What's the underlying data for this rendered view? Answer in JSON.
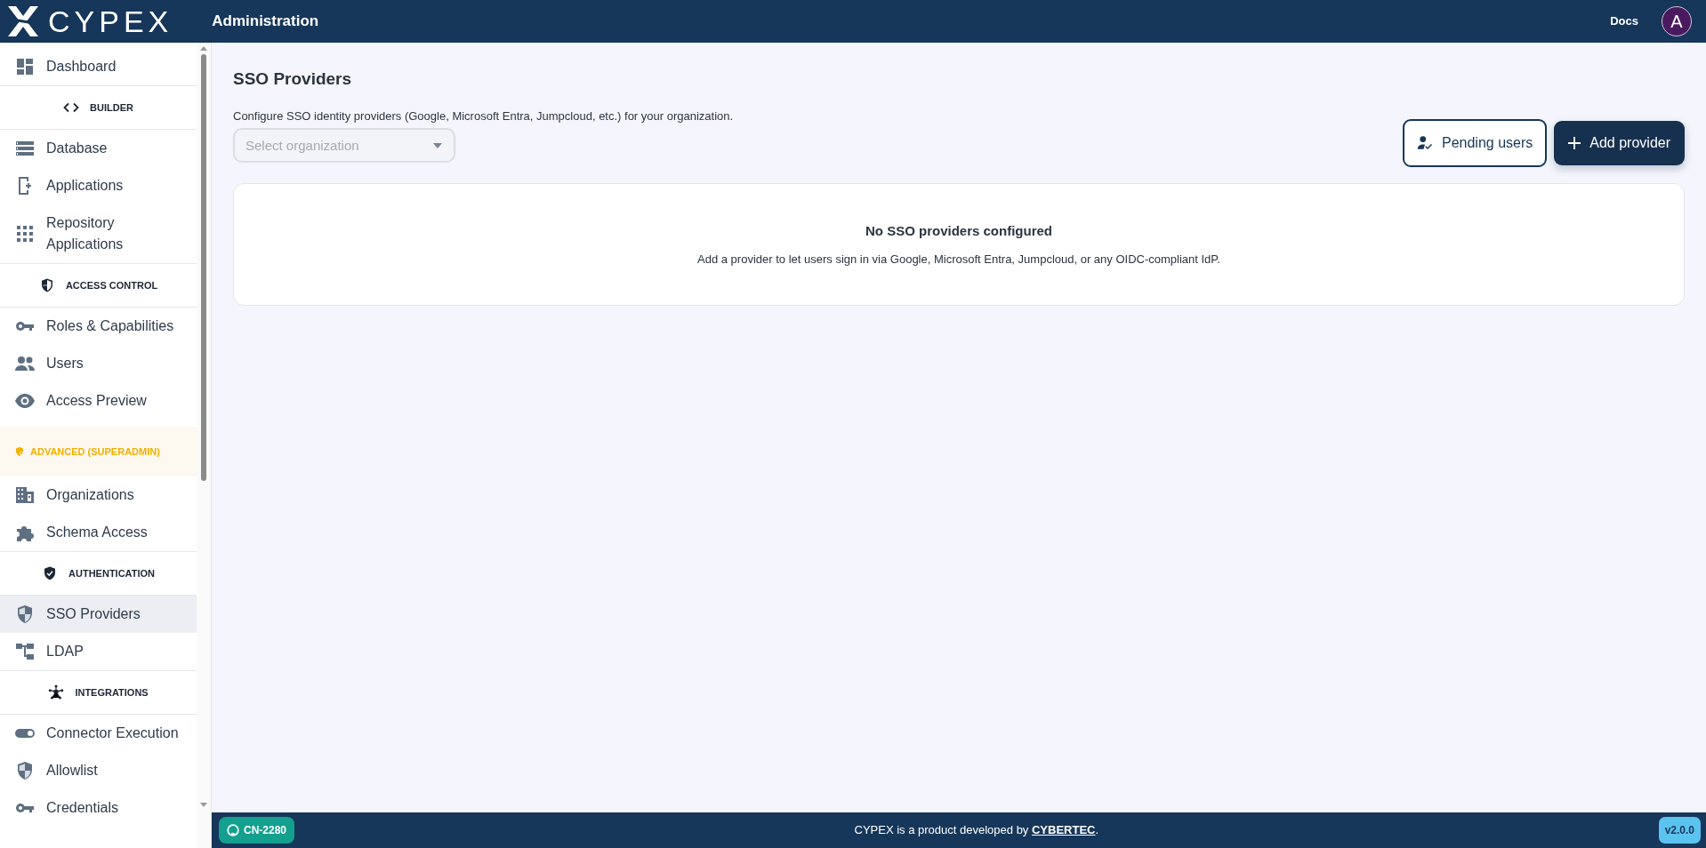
{
  "header": {
    "logo": "CYPEX",
    "title": "Administration",
    "docs_link": "Docs",
    "avatar": "A"
  },
  "sidebar": {
    "items": [
      {
        "kind": "item",
        "label": "Dashboard",
        "selected": false
      },
      {
        "kind": "section",
        "label": "BUILDER"
      },
      {
        "kind": "item",
        "label": "Database",
        "selected": false
      },
      {
        "kind": "item",
        "label": "Applications",
        "selected": false
      },
      {
        "kind": "item",
        "label": "Repository Applications",
        "selected": false
      },
      {
        "kind": "section",
        "label": "ACCESS CONTROL"
      },
      {
        "kind": "item",
        "label": "Roles & Capabilities",
        "selected": false
      },
      {
        "kind": "item",
        "label": "Users",
        "selected": false
      },
      {
        "kind": "item",
        "label": "Access Preview",
        "selected": false
      },
      {
        "kind": "superadmin",
        "label": "ADVANCED (SUPERADMIN)"
      },
      {
        "kind": "item",
        "label": "Organizations",
        "selected": false
      },
      {
        "kind": "item",
        "label": "Schema Access",
        "selected": false
      },
      {
        "kind": "section",
        "label": "AUTHENTICATION"
      },
      {
        "kind": "item",
        "label": "SSO Providers",
        "selected": true
      },
      {
        "kind": "item",
        "label": "LDAP",
        "selected": false
      },
      {
        "kind": "section",
        "label": "INTEGRATIONS"
      },
      {
        "kind": "item",
        "label": "Connector Execution",
        "selected": false
      },
      {
        "kind": "item",
        "label": "Allowlist",
        "selected": false
      },
      {
        "kind": "item",
        "label": "Credentials",
        "selected": false
      }
    ]
  },
  "page": {
    "title": "SSO Providers",
    "description": "Configure SSO identity providers (Google, Microsoft Entra, Jumpcloud, etc.) for your organization.",
    "organization_select": {
      "placeholder": "Select organization",
      "disabled": true
    },
    "buttons": [
      {
        "kind": "outline",
        "label": "Pending users"
      },
      {
        "kind": "primary",
        "label": "Add provider"
      }
    ],
    "empty_state": {
      "title": "No SSO providers configured",
      "message": "Add a provider to let users sign in via Google, Microsoft Entra, Jumpcloud, or any OIDC-compliant IdP."
    }
  },
  "footer": {
    "branch_badge": "CN-2280",
    "credit": {
      "text_before": "CYPEX is a product developed by",
      "link": "CYBERTEC",
      "text_after": "."
    },
    "version": "v2.0.0"
  }
}
